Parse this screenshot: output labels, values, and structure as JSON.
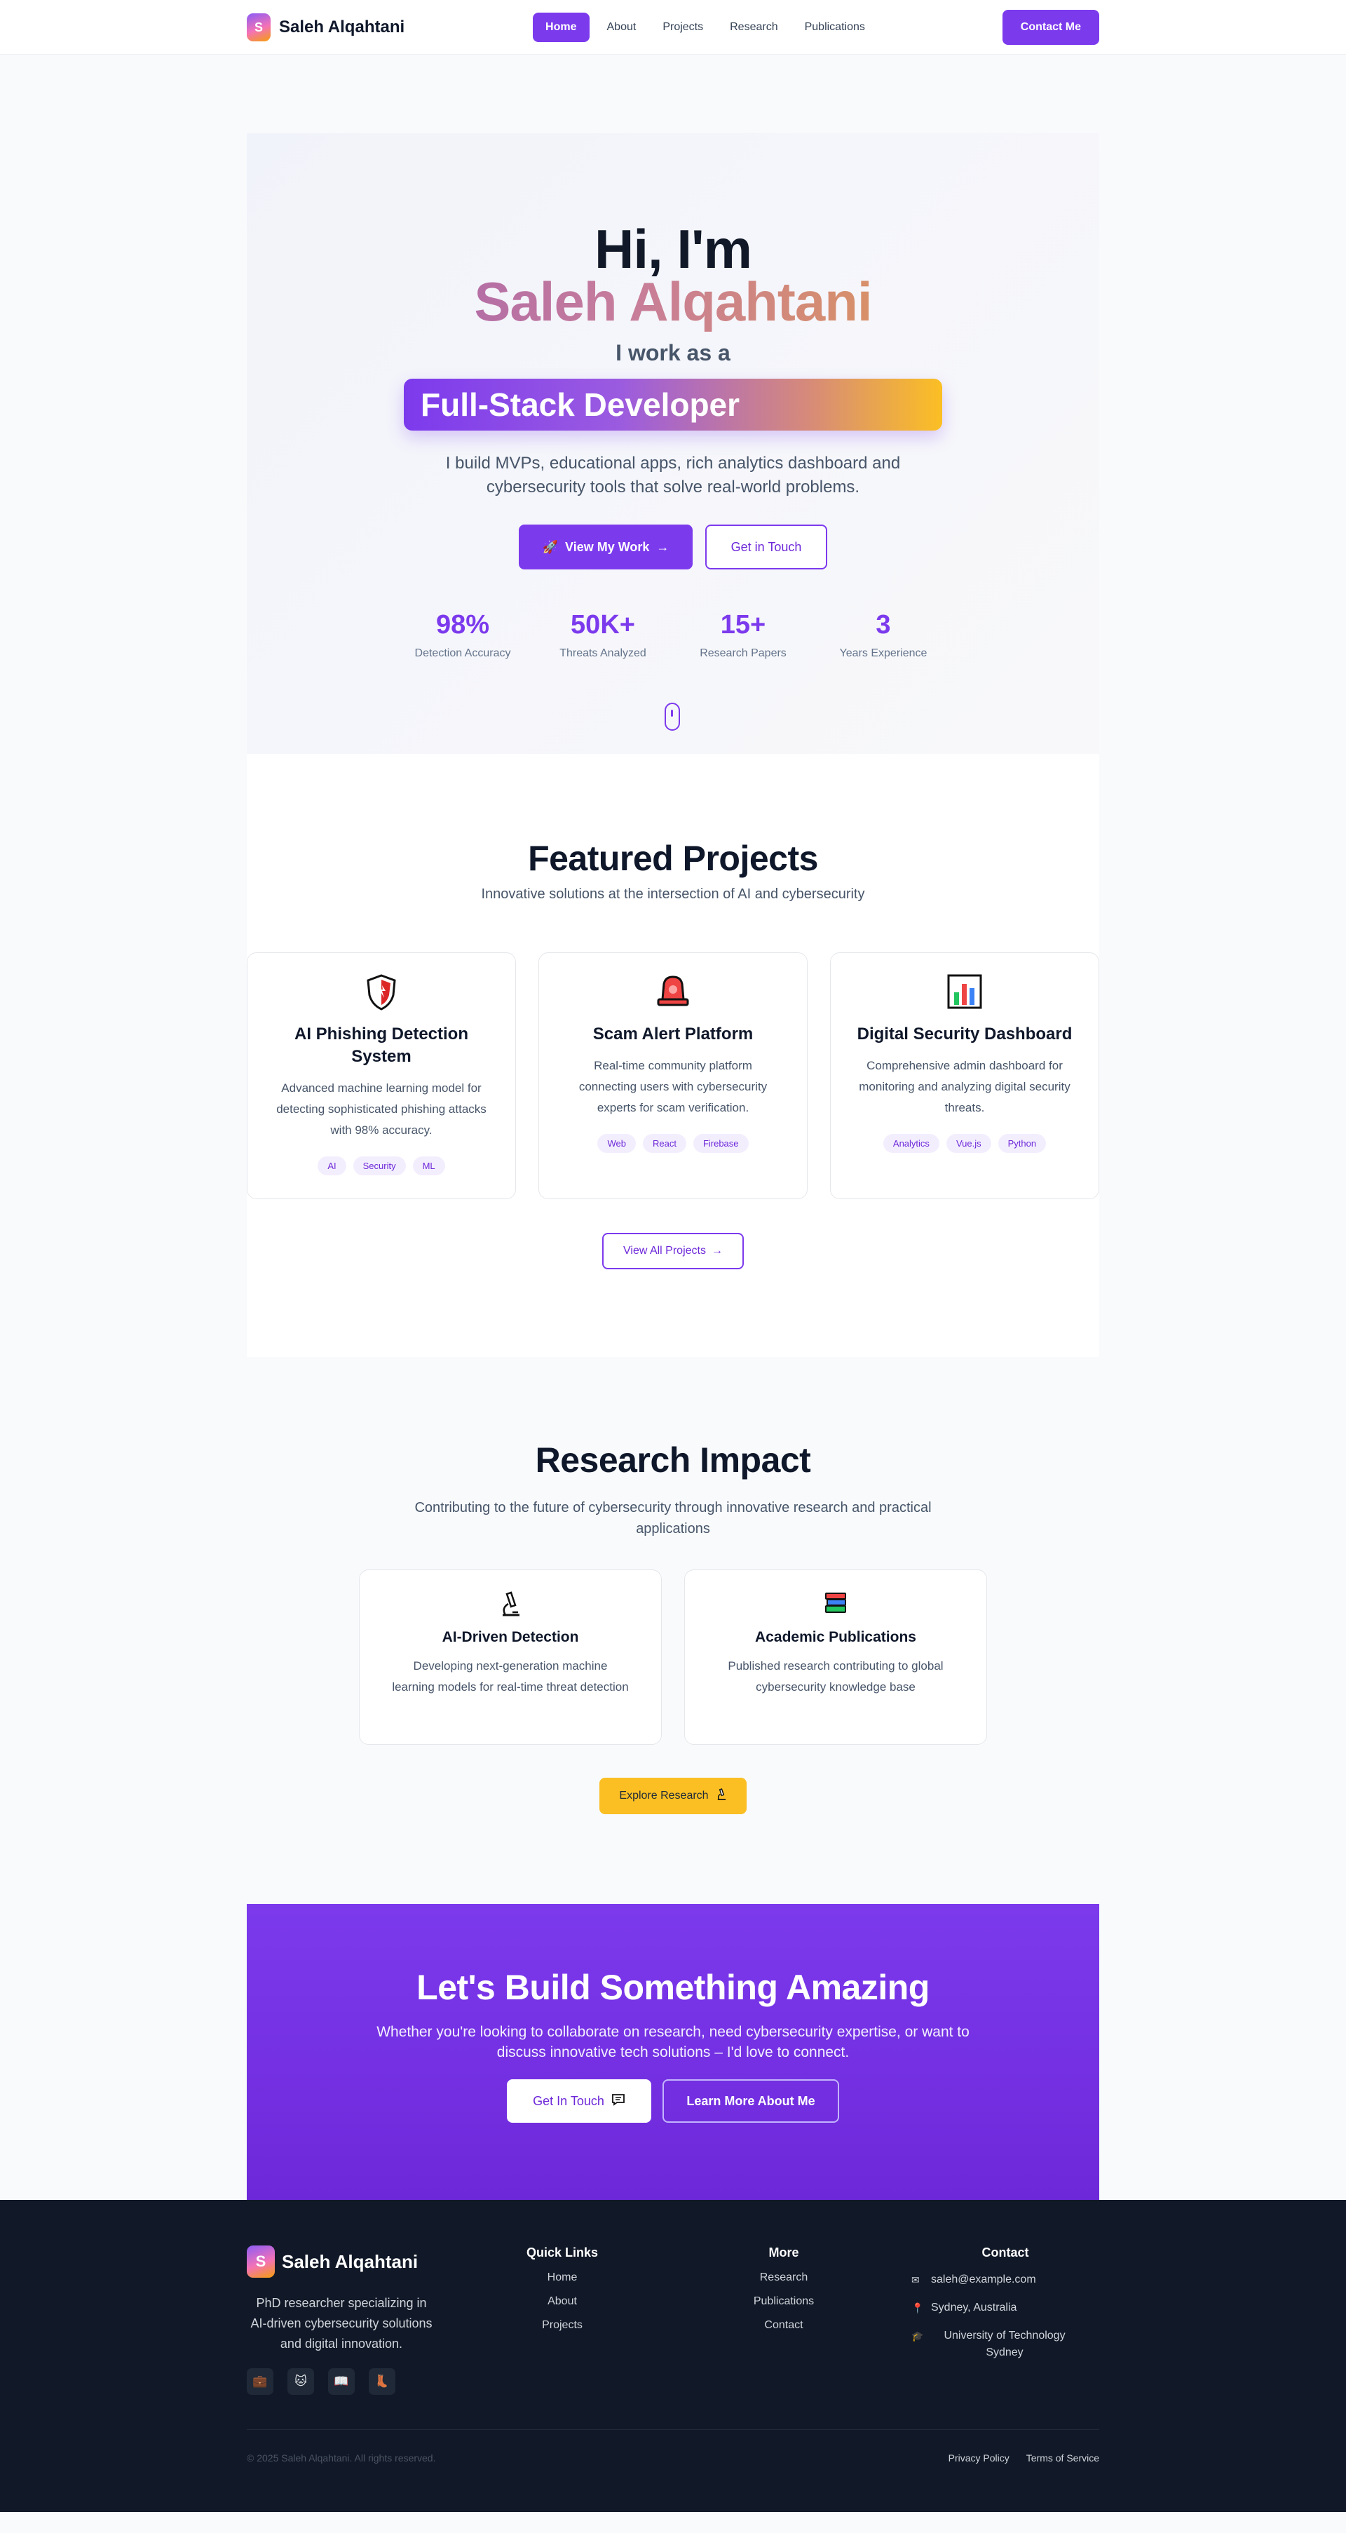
{
  "nav": {
    "logo_letter": "S",
    "brand": "Saleh Alqahtani",
    "links": [
      "Home",
      "About",
      "Projects",
      "Research",
      "Publications"
    ],
    "contact": "Contact Me"
  },
  "hero": {
    "greeting": "Hi, I'm",
    "name": "Saleh Alqahtani",
    "subtitle": "I work as a",
    "role": "Full-Stack Developer",
    "description": "I build MVPs, educational apps, rich analytics dashboard and cybersecurity tools that solve real-world problems.",
    "primary_btn": "View My Work",
    "secondary_btn": "Get in Touch",
    "stats": [
      {
        "value": "98%",
        "label": "Detection Accuracy"
      },
      {
        "value": "50K+",
        "label": "Threats Analyzed"
      },
      {
        "value": "15+",
        "label": "Research Papers"
      },
      {
        "value": "3",
        "label": "Years Experience"
      }
    ]
  },
  "featured": {
    "title": "Featured Projects",
    "subtitle": "Innovative solutions at the intersection of AI and cybersecurity",
    "projects": [
      {
        "icon": "shield-icon",
        "title": "AI Phishing Detection System",
        "description": "Advanced machine learning model for detecting sophisticated phishing attacks with 98% accuracy.",
        "tags": [
          "AI",
          "Security",
          "ML"
        ]
      },
      {
        "icon": "siren-icon",
        "title": "Scam Alert Platform",
        "description": "Real-time community platform connecting users with cybersecurity experts for scam verification.",
        "tags": [
          "Web",
          "React",
          "Firebase"
        ]
      },
      {
        "icon": "bar-chart-icon",
        "title": "Digital Security Dashboard",
        "description": "Comprehensive admin dashboard for monitoring and analyzing digital security threats.",
        "tags": [
          "Analytics",
          "Vue.js",
          "Python"
        ]
      }
    ],
    "view_all": "View All Projects"
  },
  "research": {
    "title": "Research Impact",
    "subtitle": "Contributing to the future of cybersecurity through innovative research and practical applications",
    "cards": [
      {
        "icon": "microscope-icon",
        "title": "AI-Driven Detection",
        "description": "Developing next-generation machine learning models for real-time threat detection"
      },
      {
        "icon": "books-icon",
        "title": "Academic Publications",
        "description": "Published research contributing to global cybersecurity knowledge base"
      }
    ],
    "explore": "Explore Research"
  },
  "cta": {
    "title": "Let's Build Something Amazing",
    "description": "Whether you're looking to collaborate on research, need cybersecurity expertise, or want to discuss innovative tech solutions – I'd love to connect.",
    "primary": "Get In Touch",
    "secondary": "Learn More About Me"
  },
  "footer": {
    "brand": "Saleh Alqahtani",
    "description": "PhD researcher specializing in AI-driven cybersecurity solutions and digital innovation.",
    "quick_links_title": "Quick Links",
    "quick_links": [
      "Home",
      "About",
      "Projects"
    ],
    "more_title": "More",
    "more_links": [
      "Research",
      "Publications",
      "Contact"
    ],
    "contact_title": "Contact",
    "email": "saleh@example.com",
    "location": "Sydney, Australia",
    "university": "University of Technology Sydney",
    "copyright": "© 2025 Saleh Alqahtani. All rights reserved.",
    "privacy": "Privacy Policy",
    "terms": "Terms of Service"
  },
  "colors": {
    "accent": "#7c3aed",
    "gold": "#fbbf24",
    "footer_bg": "#111827"
  }
}
